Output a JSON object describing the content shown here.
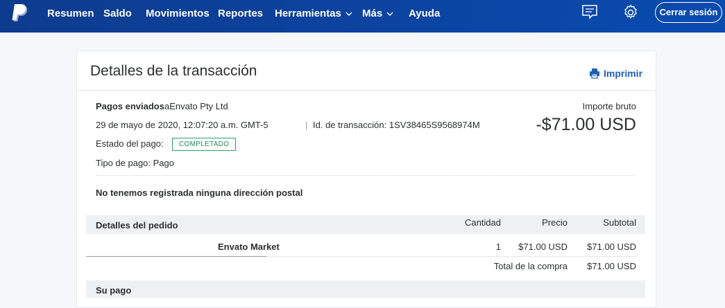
{
  "nav": {
    "items": [
      {
        "label": "Resumen"
      },
      {
        "label": "Saldo"
      },
      {
        "label": "Movimientos"
      },
      {
        "label": "Reportes"
      },
      {
        "label": "Herramientas"
      },
      {
        "label": "Más"
      },
      {
        "label": "Ayuda"
      }
    ],
    "logout_label": "Cerrar sesión",
    "icons": {
      "logo": "paypal-logo",
      "messages": "message-icon",
      "settings": "gear-icon"
    },
    "colors": {
      "bar": "#0d3b8e",
      "text": "#ffffff"
    }
  },
  "transaction": {
    "title": "Detalles de la transacción",
    "print_label": "Imprimir",
    "sent_label": "Pagos enviados",
    "recipient": "aEnvato Pty Ltd",
    "date": "29 de mayo de 2020, 12:07:20 a.m. GMT-5",
    "transaction_id_label": "Id. de transacción: 1SV38465S9568974M",
    "status_label": "Estado del pago:",
    "status_badge": "COMPLETADO",
    "payment_type": "Tipo de pago: Pago",
    "gross_label": "Importe bruto",
    "gross_amount": "-$71.00 USD",
    "no_address": "No tenemos registrada ninguna dirección postal"
  },
  "order": {
    "section_title": "Detalles del pedido",
    "columns": [
      "Cantidad",
      "Precio",
      "Subtotal"
    ],
    "items": [
      {
        "name": "Envato Market",
        "qty": "1",
        "price": "$71.00 USD",
        "subtotal": "$71.00 USD"
      }
    ],
    "total_label": "Total de la compra",
    "total_value": "$71.00 USD"
  },
  "payment": {
    "section_title": "Su pago"
  },
  "colors": {
    "accent": "#1a61b5",
    "status_green": "#2aa167",
    "band": "#eef1f4"
  }
}
